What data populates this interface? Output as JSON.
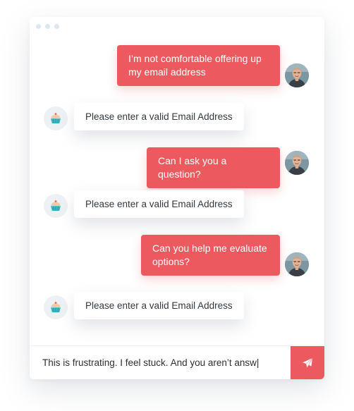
{
  "conversation": {
    "messages": [
      {
        "sender": "user",
        "text": "I’m not comfortable offering up my email address"
      },
      {
        "sender": "bot",
        "text": "Please enter a valid Email Address"
      },
      {
        "sender": "user",
        "text": "Can I ask you a question?"
      },
      {
        "sender": "bot",
        "text": "Please enter a valid Email Address"
      },
      {
        "sender": "user",
        "text": "Can you help me evaluate options?"
      },
      {
        "sender": "bot",
        "text": "Please enter a valid Email Address"
      }
    ]
  },
  "composer": {
    "value": "This is frustrating. I feel stuck. And you aren’t answ|",
    "send_icon": "paper-plane-icon"
  },
  "colors": {
    "accent": "#ec5a5f",
    "bot_bubble": "#ffffff",
    "bot_avatar_bg": "#eef1f4",
    "window_dots": "#dbe7f2"
  },
  "icons": {
    "bot_avatar": "cupcake-icon",
    "user_avatar": "user-photo"
  }
}
